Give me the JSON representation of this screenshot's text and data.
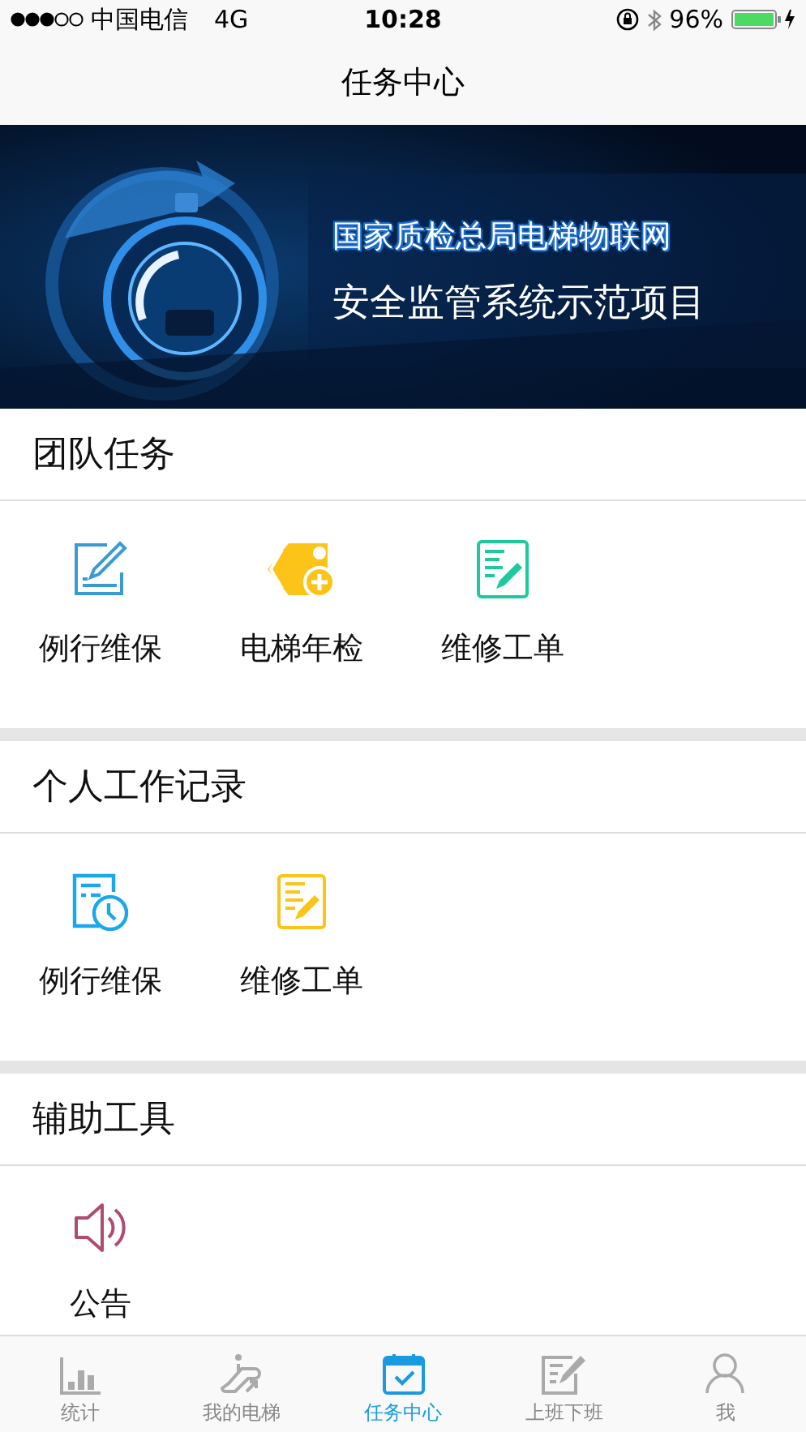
{
  "status_bar": {
    "carrier": "中国电信",
    "network": "4G",
    "time": "10:28",
    "battery": "96%"
  },
  "nav": {
    "title": "任务中心"
  },
  "banner": {
    "kind": "picture",
    "headline": "国家质检总局电梯物联网",
    "subline": "安全监管系统示范项目"
  },
  "sections": [
    {
      "title": "团队任务",
      "items": [
        {
          "label": "例行维保"
        },
        {
          "label": "电梯年检"
        },
        {
          "label": "维修工单"
        }
      ]
    },
    {
      "title": "个人工作记录",
      "items": [
        {
          "label": "例行维保"
        },
        {
          "label": "维修工单"
        }
      ]
    },
    {
      "title": "辅助工具",
      "items": [
        {
          "label": "公告"
        }
      ]
    }
  ],
  "tabs": [
    {
      "label": "统计",
      "selected": false
    },
    {
      "label": "我的电梯",
      "selected": false
    },
    {
      "label": "任务中心",
      "selected": true
    },
    {
      "label": "上班下班",
      "selected": false
    },
    {
      "label": "我",
      "selected": false
    }
  ]
}
